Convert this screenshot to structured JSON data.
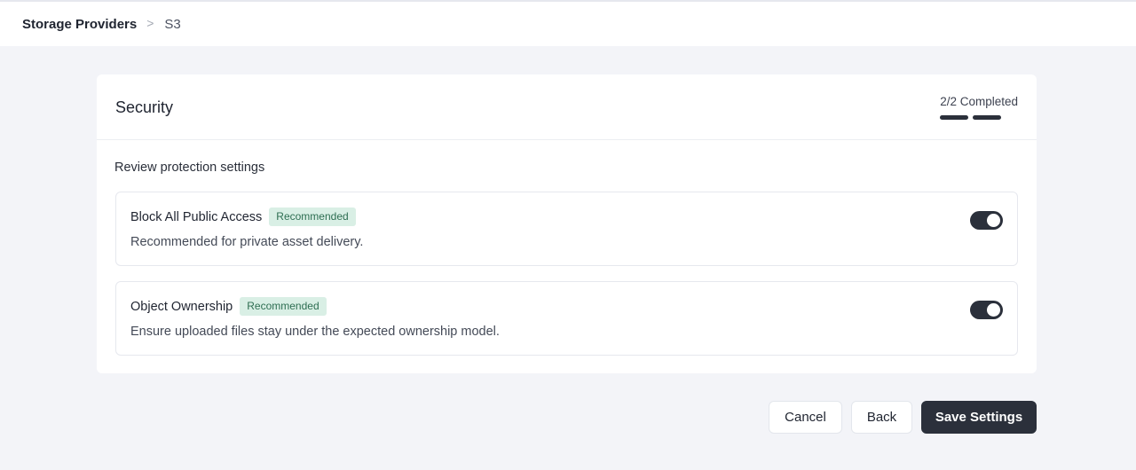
{
  "breadcrumb": {
    "root": "Storage Providers",
    "separator": ">",
    "current": "S3"
  },
  "security": {
    "title": "Security",
    "progress": {
      "text": "2/2 Completed",
      "completed": 2,
      "total": 2
    },
    "section_label": "Review protection settings",
    "options": [
      {
        "title": "Block All Public Access",
        "badge": "Recommended",
        "description": "Recommended for private asset delivery.",
        "enabled": true
      },
      {
        "title": "Object Ownership",
        "badge": "Recommended",
        "description": "Ensure uploaded files stay under the expected ownership model.",
        "enabled": true
      }
    ]
  },
  "actions": {
    "cancel_label": "Cancel",
    "back_label": "Back",
    "save_label": "Save Settings"
  },
  "colors": {
    "page_background": "#f3f4f8",
    "primary": "#2b303b",
    "badge_background": "#d9efe5",
    "badge_text": "#2e6e52"
  }
}
